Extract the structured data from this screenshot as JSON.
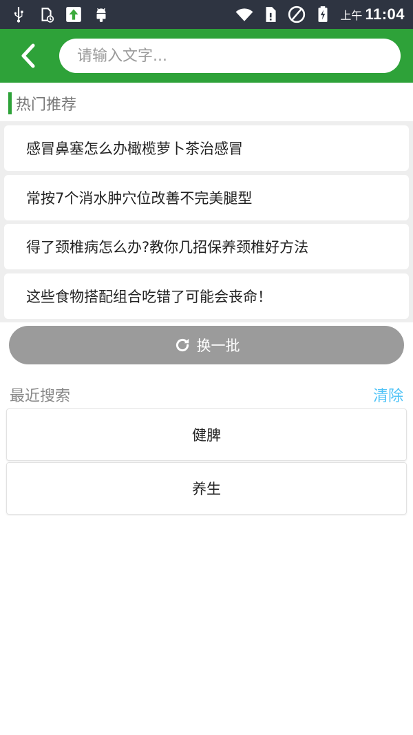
{
  "status_bar": {
    "left_icons": [
      "usb-icon",
      "sd-card-icon",
      "upload-icon",
      "android-icon"
    ],
    "right_icons": [
      "wifi-icon",
      "sim-alert-icon",
      "no-signal-icon",
      "battery-charging-icon"
    ],
    "ampm": "上午",
    "time": "11:04"
  },
  "header": {
    "back_icon": "back-arrow-icon",
    "search_placeholder": "请输入文字..."
  },
  "hot": {
    "title": "热门推荐",
    "items": [
      "感冒鼻塞怎么办橄榄萝卜茶治感冒",
      "常按7个消水肿穴位改善不完美腿型",
      "得了颈椎病怎么办?教你几招保养颈椎好方法",
      "这些食物搭配组合吃错了可能会丧命！"
    ],
    "refresh_label": "换一批",
    "refresh_icon": "refresh-icon"
  },
  "recent": {
    "title": "最近搜索",
    "clear_label": "清除",
    "items": [
      "健脾",
      "养生"
    ]
  },
  "colors": {
    "header_green": "#2ea239",
    "status_bar": "#2e3441",
    "refresh_button": "#9b9b9b",
    "clear_link": "#4fc3f7"
  }
}
